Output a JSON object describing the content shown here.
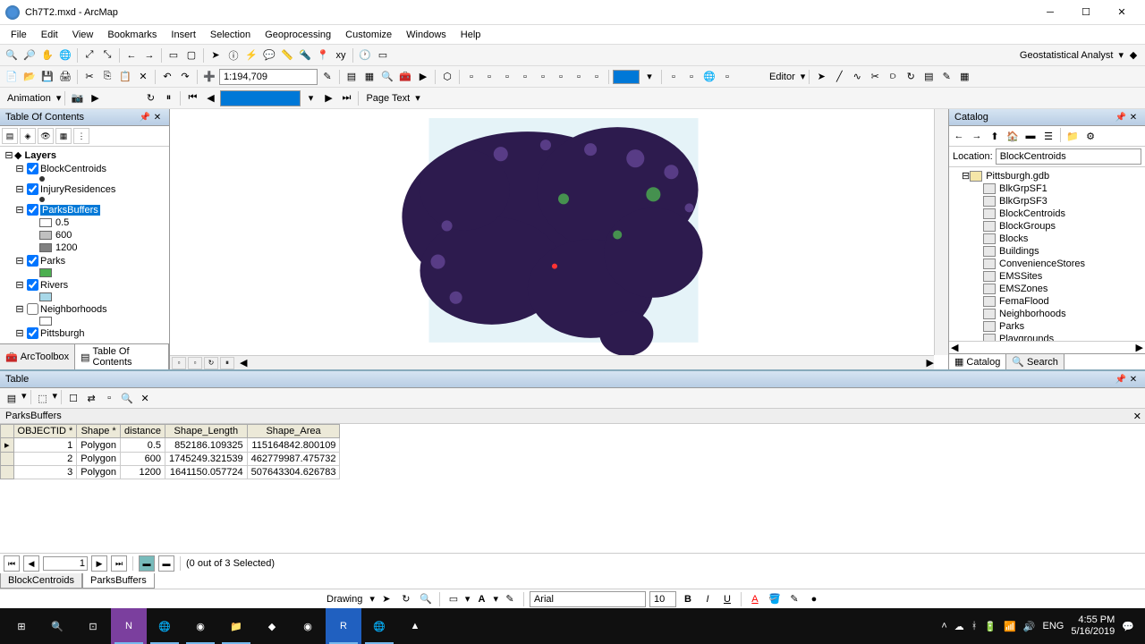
{
  "window": {
    "title": "Ch7T2.mxd - ArcMap"
  },
  "menu": [
    "File",
    "Edit",
    "View",
    "Bookmarks",
    "Insert",
    "Selection",
    "Geoprocessing",
    "Customize",
    "Windows",
    "Help"
  ],
  "toolbar1": {
    "scale": "1:194,709",
    "geostat": "Geostatistical Analyst"
  },
  "toolbar2": {
    "editor": "Editor"
  },
  "toolbar3": {
    "animation": "Animation",
    "pagetext": "Page Text",
    "frame": ""
  },
  "toc": {
    "title": "Table Of Contents",
    "root": "Layers",
    "layers": [
      {
        "name": "BlockCentroids",
        "checked": true,
        "children": [],
        "symbol": "point"
      },
      {
        "name": "InjuryResidences",
        "checked": true,
        "children": [],
        "symbol": "point"
      },
      {
        "name": "ParksBuffers",
        "checked": true,
        "selected": true,
        "children": [
          {
            "label": "0.5",
            "swatch": "#ffffff"
          },
          {
            "label": "600",
            "swatch": "#c0c0c0"
          },
          {
            "label": "1200",
            "swatch": "#808080"
          }
        ]
      },
      {
        "name": "Parks",
        "checked": true,
        "children": [
          {
            "label": "",
            "swatch": "#4caf50"
          }
        ]
      },
      {
        "name": "Rivers",
        "checked": true,
        "children": [
          {
            "label": "",
            "swatch": "#a8d8e8"
          }
        ]
      },
      {
        "name": "Neighborhoods",
        "checked": false,
        "children": [
          {
            "label": "",
            "swatch": "#ffffff"
          }
        ]
      },
      {
        "name": "Pittsburgh",
        "checked": true,
        "children": []
      }
    ],
    "tabs": {
      "arctoolbox": "ArcToolbox",
      "toc": "Table Of Contents"
    }
  },
  "catalog": {
    "title": "Catalog",
    "location_label": "Location:",
    "location": "BlockCentroids",
    "root": "Pittsburgh.gdb",
    "items": [
      "BlkGrpSF1",
      "BlkGrpSF3",
      "BlockCentroids",
      "BlockGroups",
      "Blocks",
      "Buildings",
      "ConvenienceStores",
      "EMSSites",
      "EMSZones",
      "FemaFlood",
      "Neighborhoods",
      "Parks",
      "Playgrounds"
    ],
    "tabs": {
      "catalog": "Catalog",
      "search": "Search"
    }
  },
  "table": {
    "title": "Table",
    "layer": "ParksBuffers",
    "columns": [
      "OBJECTID *",
      "Shape *",
      "distance",
      "Shape_Length",
      "Shape_Area"
    ],
    "rows": [
      [
        "1",
        "Polygon",
        "0.5",
        "852186.109325",
        "115164842.800109"
      ],
      [
        "2",
        "Polygon",
        "600",
        "1745249.321539",
        "462779987.475732"
      ],
      [
        "3",
        "Polygon",
        "1200",
        "1641150.057724",
        "507643304.626783"
      ]
    ],
    "nav": {
      "rec": "1",
      "status": "(0 out of 3 Selected)"
    },
    "tabs": [
      "BlockCentroids",
      "ParksBuffers"
    ]
  },
  "drawing": {
    "label": "Drawing",
    "font": "Arial",
    "size": "10"
  },
  "taskbar": {
    "time": "4:55 PM",
    "date": "5/16/2019",
    "lang": "ENG"
  }
}
